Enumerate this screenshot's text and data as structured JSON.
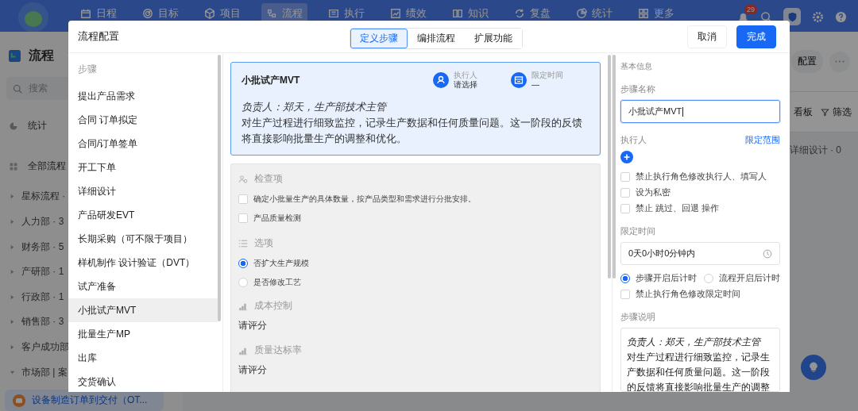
{
  "nav": {
    "items": [
      {
        "label": "日程",
        "selected": false
      },
      {
        "label": "目标",
        "selected": false
      },
      {
        "label": "项目",
        "selected": false
      },
      {
        "label": "流程",
        "selected": true
      },
      {
        "label": "执行",
        "selected": false
      },
      {
        "label": "绩效",
        "selected": false
      },
      {
        "label": "知识",
        "selected": false
      },
      {
        "label": "复盘",
        "selected": false
      },
      {
        "label": "统计",
        "selected": false
      },
      {
        "label": "更多",
        "selected": false
      }
    ],
    "notification_count": "29"
  },
  "sidebar": {
    "title": "流程",
    "search_placeholder": "搜索",
    "stats": "统计",
    "all_flows": "全部流程",
    "groups": [
      {
        "label": "星标流程 ·",
        "expanded": false
      },
      {
        "label": "人力部 · 3",
        "expanded": false
      },
      {
        "label": "财务部 · 5",
        "expanded": false
      },
      {
        "label": "产研部 · 1",
        "expanded": false
      },
      {
        "label": "行政部 · 1",
        "expanded": false
      },
      {
        "label": "销售部 · 3",
        "expanded": false
      },
      {
        "label": "客户成功部",
        "expanded": false
      },
      {
        "label": "市场部 | 案",
        "expanded": true
      }
    ],
    "active_flow": "设备制造订单到交付（OT..."
  },
  "main": {
    "config_button": "配置",
    "board": "看板",
    "filter": "筛选",
    "column": "详细设计 · 0"
  },
  "dialog": {
    "title": "流程配置",
    "tabs": [
      {
        "label": "定义步骤",
        "selected": true
      },
      {
        "label": "编排流程",
        "selected": false
      },
      {
        "label": "扩展功能",
        "selected": false
      }
    ],
    "cancel": "取消",
    "done": "完成",
    "steps_heading": "步骤",
    "steps": [
      {
        "label": "提出产品需求",
        "selected": false
      },
      {
        "label": "合同 订单拟定",
        "selected": false
      },
      {
        "label": "合同/订单签单",
        "selected": false
      },
      {
        "label": "开工下单",
        "selected": false
      },
      {
        "label": "详细设计",
        "selected": false
      },
      {
        "label": "产品研发EVT",
        "selected": false
      },
      {
        "label": "长期采购（可不限于项目）",
        "selected": false
      },
      {
        "label": "样机制作 设计验证（DVT）",
        "selected": false
      },
      {
        "label": "试产准备",
        "selected": false
      },
      {
        "label": "小批试产MVT",
        "selected": true
      },
      {
        "label": "批量生产MP",
        "selected": false
      },
      {
        "label": "出库",
        "selected": false
      },
      {
        "label": "交货确认",
        "selected": false
      }
    ],
    "step_card": {
      "title": "小批试产MVT",
      "executor_label": "执行人",
      "executor_value": "请选择",
      "time_label": "限定时间",
      "time_value": "—",
      "lead": "负责人：郑天，生产部技术主管",
      "description": "对生产过程进行细致监控，记录生产数据和任何质量问题。这一阶段的反馈将直接影响批量生产的调整和优化。"
    },
    "checks": {
      "title": "检查项",
      "items": [
        {
          "label": "确定小批量生产的具体数量，按产品类型和需求进行分批安排。",
          "checked": false
        },
        {
          "label": "产品质量检测",
          "checked": false
        }
      ]
    },
    "options": {
      "title": "选项",
      "items": [
        {
          "label": "否扩大生产规模",
          "selected": true
        },
        {
          "label": "是否修改工艺",
          "selected": false
        }
      ]
    },
    "ratings": [
      {
        "title": "成本控制",
        "prompt": "请评分"
      },
      {
        "title": "质量达标率",
        "prompt": "请评分"
      }
    ],
    "info": {
      "heading": "基本信息",
      "name_label": "步骤名称",
      "name_value": "小批试产MVT",
      "executor_label": "执行人",
      "scope_link": "限定范围",
      "permissions": [
        {
          "label": "禁止执行角色修改执行人、填写人",
          "checked": false
        },
        {
          "label": "设为私密",
          "checked": false
        },
        {
          "label": "禁止 跳过、回退 操作",
          "checked": false
        }
      ],
      "time_label": "限定时间",
      "time_value": "0天0小时0分钟内",
      "timing": [
        {
          "label": "步骤开启后计时",
          "selected": true
        },
        {
          "label": "流程开启后计时",
          "selected": false
        }
      ],
      "time_lock": {
        "label": "禁止执行角色修改限定时间",
        "checked": false
      },
      "description_label": "步骤说明",
      "description_lead": "负责人：郑天，生产部技术主管",
      "description": "对生产过程进行细致监控，记录生产数据和任何质量问题。这一阶段的反馈将直接影响批量生产的调整"
    }
  }
}
